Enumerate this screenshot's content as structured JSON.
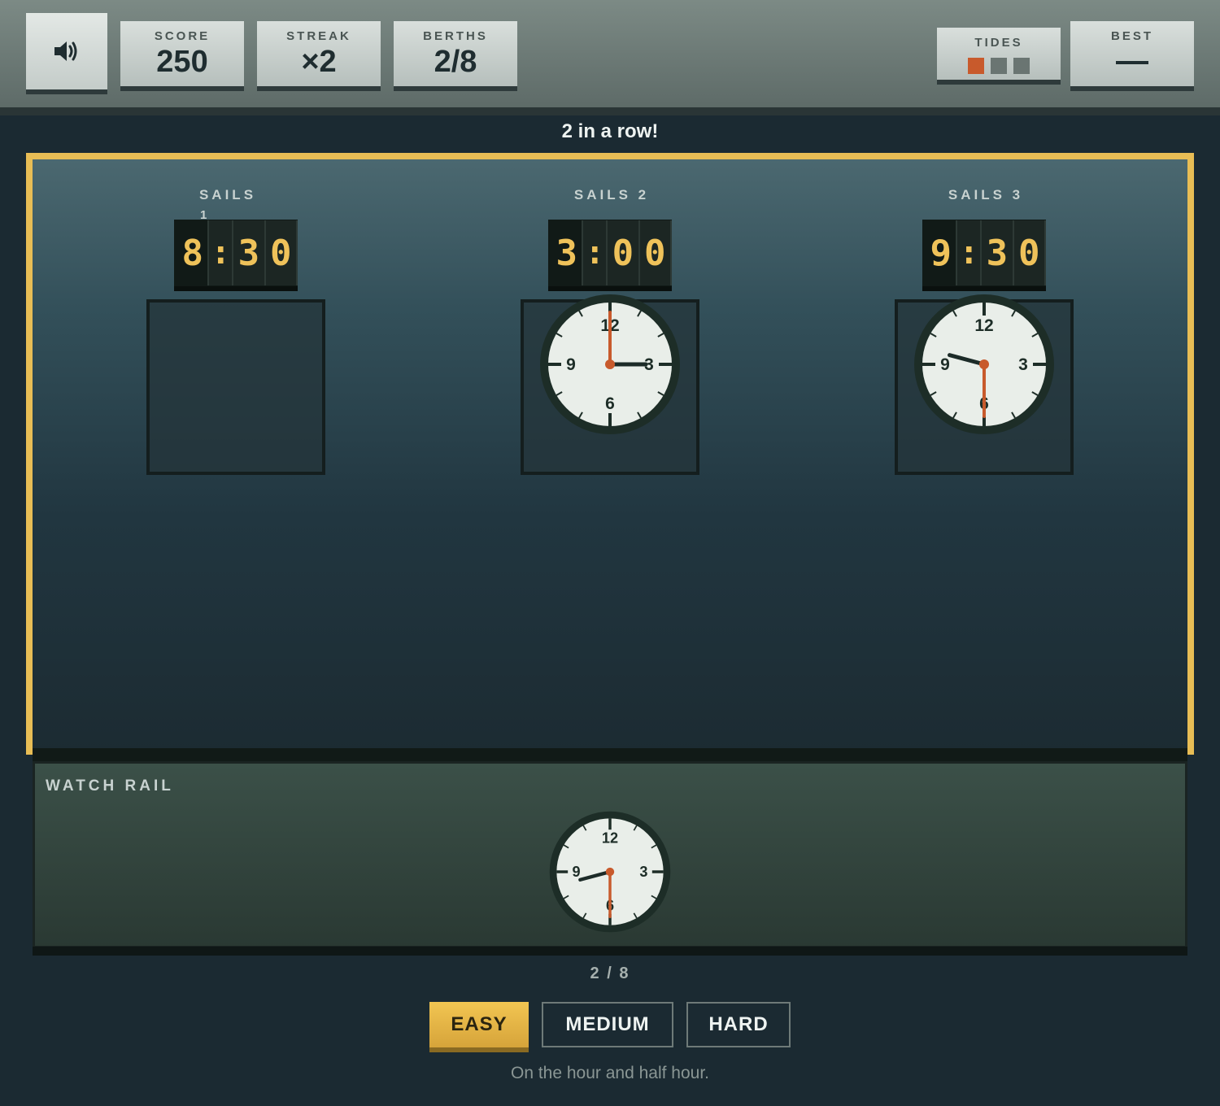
{
  "hud": {
    "sound_icon": "speaker-icon",
    "score": {
      "label": "SCORE",
      "value": "250"
    },
    "streak": {
      "label": "STREAK",
      "value": "×2"
    },
    "berths": {
      "label": "BERTHS",
      "value": "2/8"
    },
    "tides": {
      "label": "TIDES",
      "total": 3,
      "filled": 1,
      "filled_color": "#c85a2c"
    },
    "best": {
      "label": "BEST",
      "value": "—"
    }
  },
  "status": "2 in a row!",
  "berths": [
    {
      "title": "SAILS",
      "number": "1",
      "digits": [
        "8",
        ":",
        "3",
        "0"
      ],
      "docked_clock": null
    },
    {
      "title": "SAILS",
      "number": "2",
      "digits": [
        "3",
        ":",
        "0",
        "0"
      ],
      "docked_clock": {
        "hour": 3,
        "minute": 0
      }
    },
    {
      "title": "SAILS",
      "number": "3",
      "digits": [
        "9",
        ":",
        "3",
        "0"
      ],
      "docked_clock": {
        "hour": 9,
        "minute": 30
      }
    }
  ],
  "rail": {
    "title": "WATCH RAIL",
    "clock": {
      "hour": 8,
      "minute": 30
    }
  },
  "clock_numerals": [
    "12",
    "3",
    "6",
    "9"
  ],
  "progress": "2 / 8",
  "difficulty": [
    {
      "label": "EASY",
      "selected": true
    },
    {
      "label": "MEDIUM",
      "selected": false
    },
    {
      "label": "HARD",
      "selected": false
    }
  ],
  "hint": "On the hour and half hour.",
  "colors": {
    "accent": "#e8bd55",
    "hand_minute": "#c85a2c",
    "hand_hour": "#1c2b28"
  }
}
